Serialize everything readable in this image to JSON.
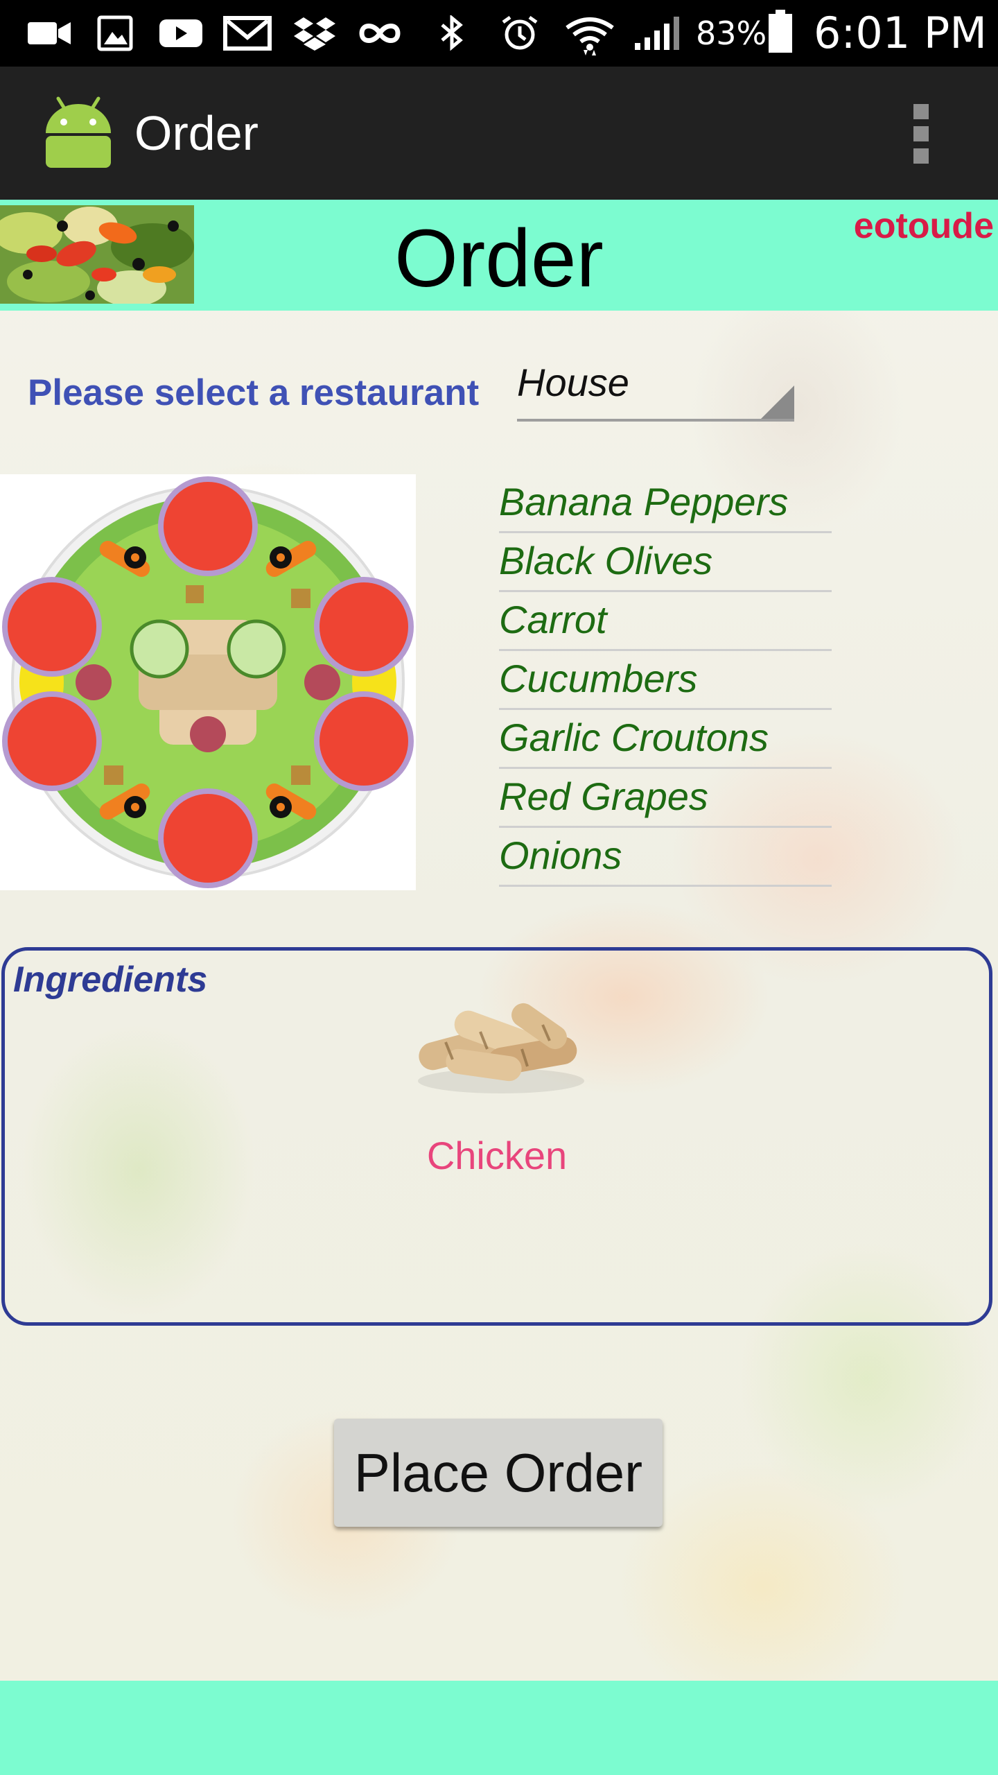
{
  "status_bar": {
    "battery_percent": "83%",
    "time": "6:01 PM",
    "icons": [
      "video-camera-icon",
      "image-icon",
      "youtube-icon",
      "gmail-icon",
      "dropbox-icon",
      "infinity-icon",
      "bluetooth-icon",
      "alarm-icon",
      "wifi-icon",
      "signal-icon",
      "battery-icon"
    ]
  },
  "action_bar": {
    "title": "Order",
    "app_icon": "android-icon",
    "menu_icon": "overflow-menu-icon"
  },
  "header": {
    "title": "Order",
    "username": "eotoude"
  },
  "restaurant": {
    "label": "Please select a restaurant",
    "selected": "House"
  },
  "toppings": [
    "Banana Peppers",
    "Black Olives",
    "Carrot",
    "Cucumbers",
    "Garlic Croutons",
    "Red Grapes",
    "Onions"
  ],
  "ingredients": {
    "title": "Ingredients",
    "item_label": "Chicken"
  },
  "actions": {
    "place_order_label": "Place Order"
  },
  "colors": {
    "header_band": "#7cfcd0",
    "username": "#d81b47",
    "restaurant_label": "#3f51b5",
    "topping_text": "#1d6b12",
    "ingredients_border": "#2e3b94",
    "chicken_label": "#e8457c"
  }
}
